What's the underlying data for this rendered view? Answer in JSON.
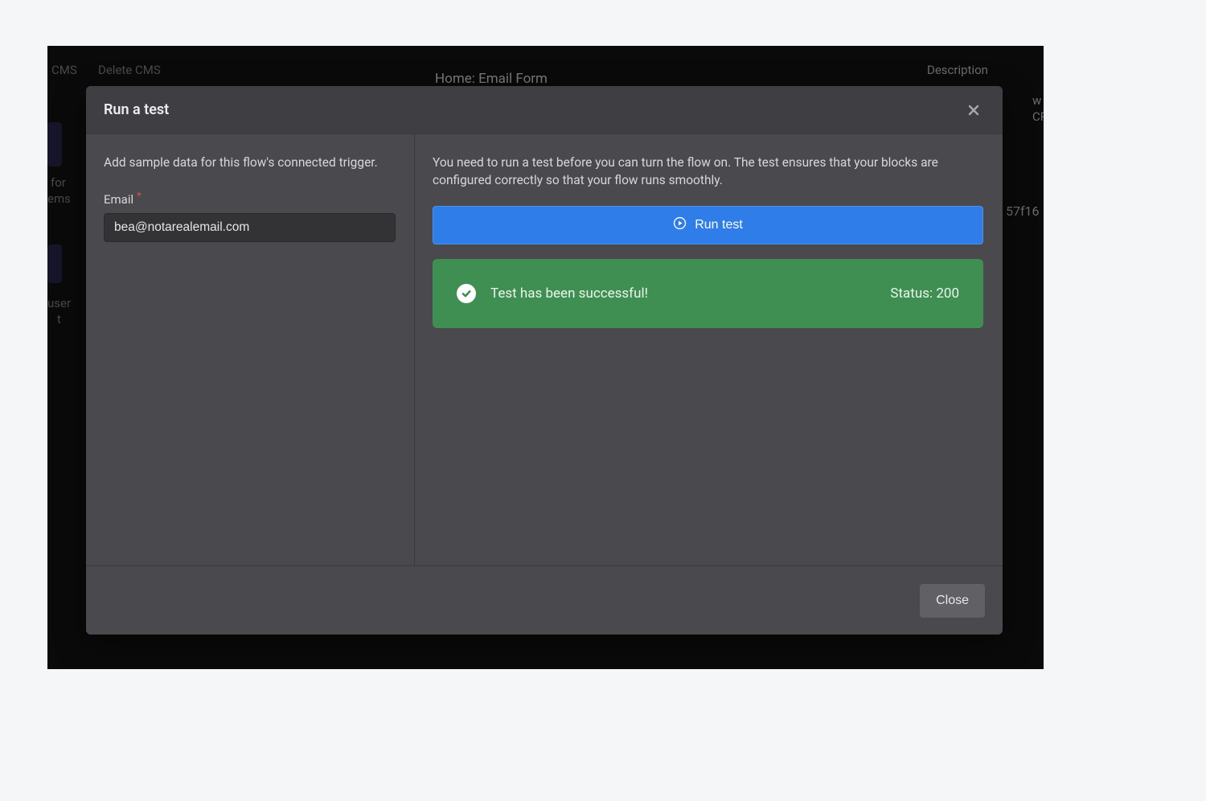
{
  "background": {
    "breadcrumb": "Home: Email Form",
    "col_cms": "CMS",
    "col_delete": "Delete CMS",
    "desc_header": "Description",
    "desc_line1": "w will",
    "desc_line2": "CRM",
    "hash": "57f16",
    "row_for": "for",
    "row_ems": "ems",
    "row_user": "user",
    "row_t": "t"
  },
  "modal": {
    "title": "Run a test",
    "left_intro": "Add sample data for this flow's connected trigger.",
    "email_label": "Email",
    "email_value": "bea@notarealemail.com",
    "right_note": "You need to run a test before you can turn the flow on. The test ensures that your blocks are configured correctly so that your flow runs smoothly.",
    "run_button_label": "Run test",
    "success_message": "Test has been successful!",
    "status_label": "Status: 200",
    "footer_close": "Close"
  }
}
